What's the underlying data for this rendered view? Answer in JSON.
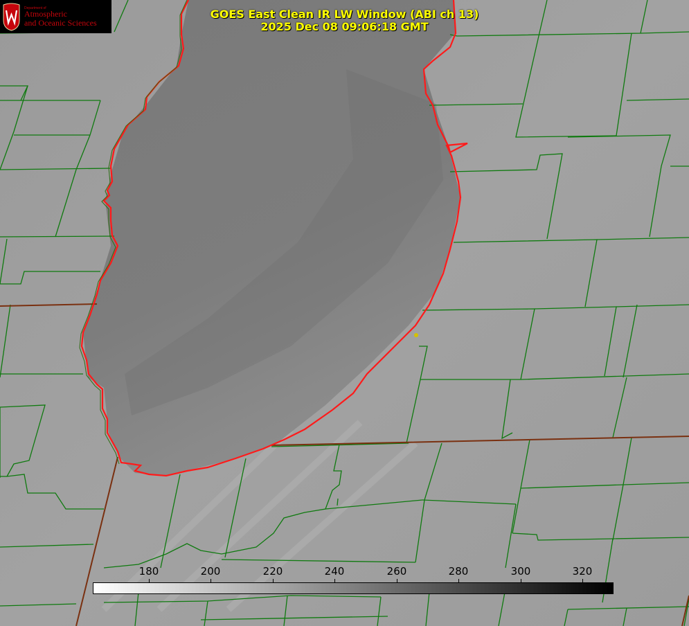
{
  "title": {
    "line1": "GOES East Clean IR LW Window (ABI ch 13)",
    "line2": "2025 Dec 08 09:06:18 GMT"
  },
  "logo": {
    "dept": "Department of",
    "line1": "Atmospheric",
    "line2": "and Oceanic Sciences"
  },
  "colorbar": {
    "ticks": [
      "180",
      "200",
      "220",
      "240",
      "260",
      "280",
      "300",
      "320"
    ],
    "colormap": "white-to-black grayscale",
    "gradient_start": "#ffffff",
    "gradient_end": "#000000"
  },
  "colors": {
    "title": "#ffff00",
    "county_lines": "#0f7a0f",
    "coastline": "#ff1a1a",
    "state_lines": "#7a3010",
    "land": "#9e9e9e",
    "lake": "#7c7c7c",
    "marker": "#d4c200"
  }
}
